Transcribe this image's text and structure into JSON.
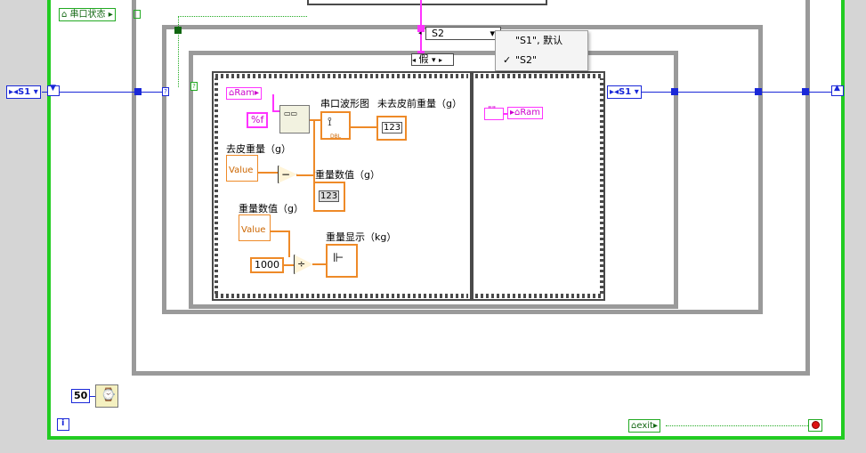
{
  "serial_state_label": "串口状态",
  "enum_in": "S1",
  "enum_out": "S2",
  "inner_case_label": "假",
  "menu": {
    "option1": "\"S1\", 默认",
    "option2": "\"S2\""
  },
  "tags": {
    "ram": "Ram",
    "format": "%f",
    "waveform_label": "串口波形图",
    "untared_label": "未去皮前重量（g）",
    "tare_label": "去皮重量（g）",
    "weight_label1": "重量数值（g）",
    "weight_label2": "重量数值（g）",
    "value1": "Value",
    "value2": "Value",
    "const1000": "1000",
    "display_label": "重量显示（kg）",
    "num_indicator": "123",
    "num_indicator2": "123",
    "dbl": "DBL"
  },
  "s1_right": "S1",
  "ram_right": "Ram",
  "wait_ms": "50",
  "exit_label": "exit",
  "colors": {
    "loop_green": "#22cc22",
    "wire_blue": "#1a28d8",
    "wire_pink": "#ff33ff",
    "wire_orange": "#ee8a28"
  }
}
